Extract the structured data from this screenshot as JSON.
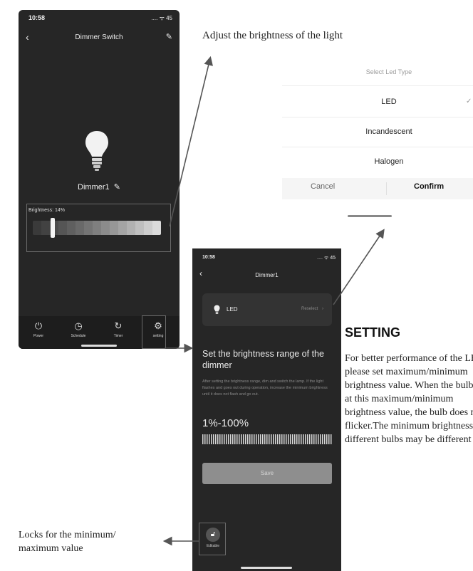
{
  "annotations": {
    "adjust_brightness": "Adjust the brightness of the light",
    "locks": "Locks for the minimum/\nmaximum value",
    "heading": "SETTING",
    "description": "For better performance of the LED, please set maximum/minimum brightness value. When the bulb is at this maximum/minimum brightness value, the bulb does not flicker.The minimum brightness of different bulbs may be different"
  },
  "phone1": {
    "time": "10:58",
    "status": ".... ᯤ 45",
    "title": "Dimmer Switch",
    "device_name": "Dimmer1",
    "brightness_label": "Brightness: 14%",
    "brightness_value": 0.14,
    "tabs": [
      {
        "label": "Power",
        "icon": "power-icon"
      },
      {
        "label": "Schedule",
        "icon": "clock-icon"
      },
      {
        "label": "Timer",
        "icon": "timer-icon"
      },
      {
        "label": "setting",
        "icon": "gear-icon"
      }
    ]
  },
  "selector": {
    "title": "Select Led Type",
    "options": [
      "LED",
      "Incandescent",
      "Halogen"
    ],
    "selected": "LED",
    "cancel": "Cancel",
    "confirm": "Confirm"
  },
  "phone2": {
    "time": "10:58",
    "status": ".... ᯤ 45",
    "title": "Dimmer1",
    "led_label": "LED",
    "reselect": "Reselect",
    "range_title": "Set the brightness range of the dimmer",
    "range_desc": "After setting the brightness range, dim and switch the lamp. If the light flashes and goes out during operation, increase the minimum brightness until it does not flash and go out.",
    "range_value": "1%-100%",
    "save": "Save",
    "editable": "Editable"
  },
  "colors": {
    "phone_bg": "#262626",
    "text_dark": "#111111",
    "arrow": "#555555"
  }
}
